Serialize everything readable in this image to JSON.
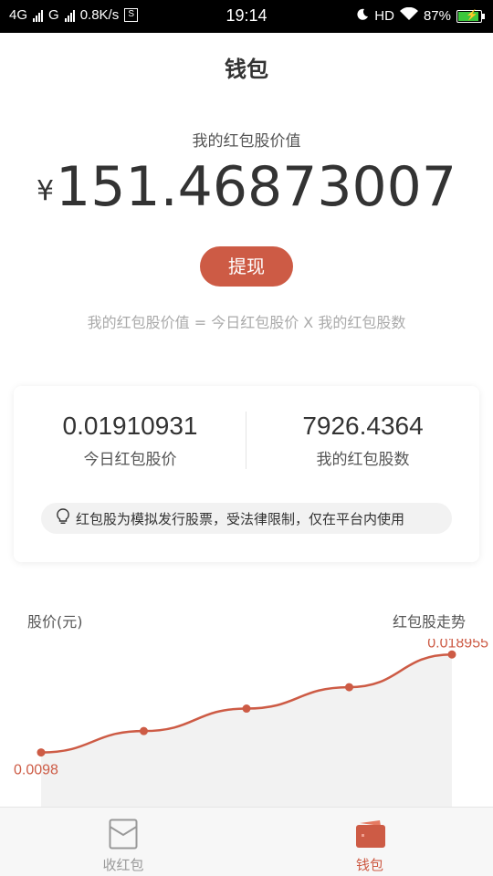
{
  "status_bar": {
    "net1": "4G",
    "net2": "G",
    "speed": "0.8K/s",
    "s_badge": "S",
    "time": "19:14",
    "hd": "HD",
    "battery": "87%"
  },
  "header": {
    "title": "钱包"
  },
  "wallet": {
    "value_label": "我的红包股价值",
    "currency": "¥",
    "value": "151.46873007",
    "withdraw_label": "提现",
    "formula": "我的红包股价值 = 今日红包股价 X 我的红包股数"
  },
  "stats": {
    "price_value": "0.01910931",
    "price_label": "今日红包股价",
    "shares_value": "7926.4364",
    "shares_label": "我的红包股数",
    "notice": "红包股为模拟发行股票，受法律限制，仅在平台内使用"
  },
  "chart_header": {
    "ylabel": "股价(元)",
    "title": "红包股走势"
  },
  "chart_data": {
    "type": "line",
    "title": "红包股走势",
    "ylabel": "股价(元)",
    "xlabel": "",
    "values": [
      0.0098,
      0.0118,
      0.0139,
      0.0159,
      0.018955
    ],
    "data_labels": {
      "first": "0.0098",
      "last": "0.018955"
    },
    "ylim": [
      0.0055,
      0.02
    ],
    "line_color": "#cd5b45",
    "fill_color": "#f2f2f2",
    "grid": false
  },
  "tabbar": {
    "tabs": [
      {
        "label": "收红包",
        "icon": "envelope-icon",
        "active": false
      },
      {
        "label": "钱包",
        "icon": "wallet-icon",
        "active": true
      }
    ]
  },
  "colors": {
    "accent": "#cd5b45",
    "muted": "#aaaaaa"
  }
}
